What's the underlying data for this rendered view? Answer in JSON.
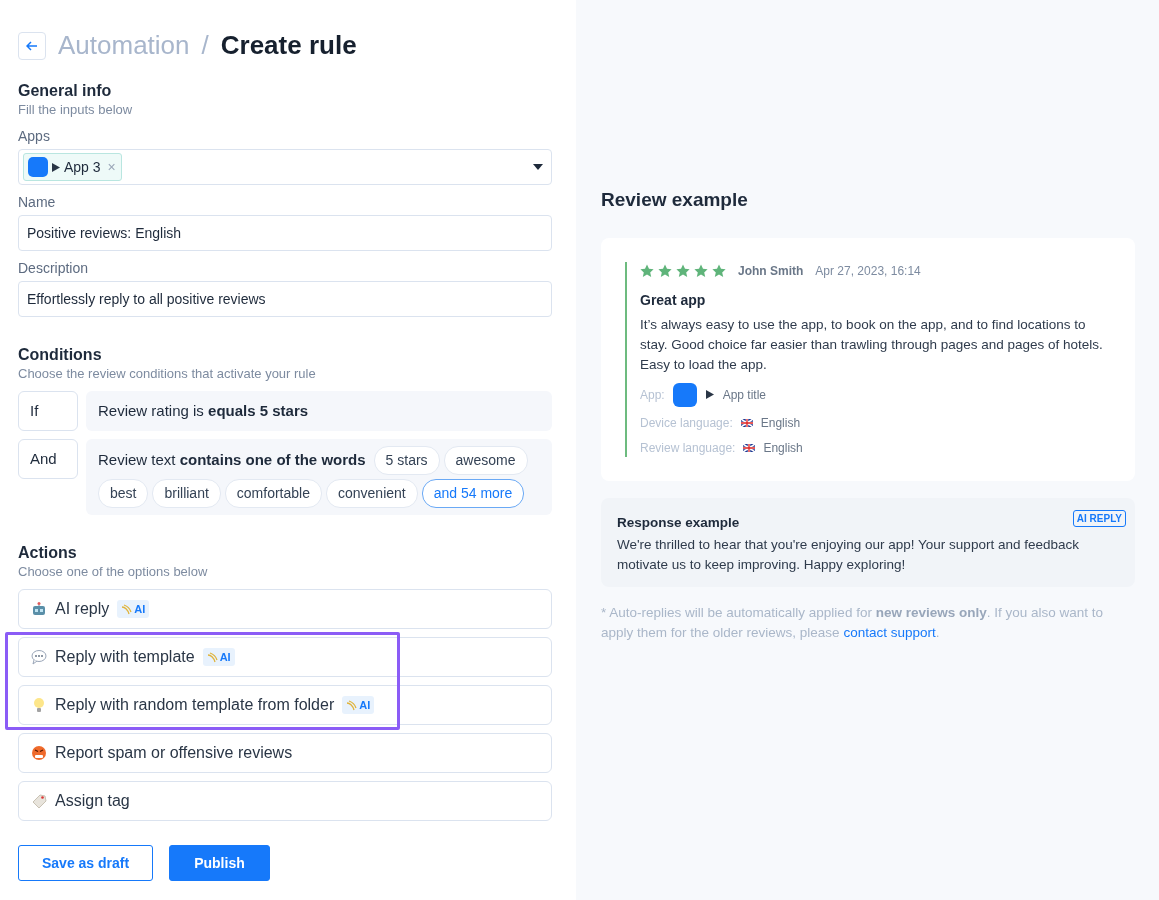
{
  "header": {
    "breadcrumb_parent": "Automation",
    "separator": "/",
    "title": "Create rule"
  },
  "general_info": {
    "heading": "General info",
    "subtitle": "Fill the inputs below",
    "apps": {
      "label": "Apps",
      "chips": [
        {
          "label": "App 3",
          "remove": "×"
        }
      ]
    },
    "name": {
      "label": "Name",
      "value": "Positive reviews: English"
    },
    "description": {
      "label": "Description",
      "value": "Effortlessly reply to all positive reviews"
    }
  },
  "conditions": {
    "heading": "Conditions",
    "subtitle": "Choose the review conditions that activate your rule",
    "rows": [
      {
        "operator": "If",
        "text": "Review rating is **equals 5 stars**",
        "tags": []
      },
      {
        "operator": "And",
        "text": "Review text **contains one of the words**",
        "tags": [
          {
            "label": "5 stars",
            "kind": "word"
          },
          {
            "label": "awesome",
            "kind": "word"
          },
          {
            "label": "best",
            "kind": "word"
          },
          {
            "label": "brilliant",
            "kind": "word"
          },
          {
            "label": "comfortable",
            "kind": "word"
          },
          {
            "label": "convenient",
            "kind": "word"
          },
          {
            "label": "and 54 more",
            "kind": "more"
          }
        ]
      }
    ]
  },
  "actions": {
    "heading": "Actions",
    "subtitle": "Choose one of the options below",
    "items": [
      {
        "label": "AI reply",
        "kind": "robot",
        "ai_badge": "AI",
        "highlighted": false
      },
      {
        "label": "Reply with template",
        "kind": "speech",
        "ai_badge": "AI",
        "highlighted": true
      },
      {
        "label": "Reply with random template from folder",
        "kind": "bulb",
        "ai_badge": "AI",
        "highlighted": true
      },
      {
        "label": "Report spam or offensive reviews",
        "kind": "angry",
        "highlighted": false
      },
      {
        "label": "Assign tag",
        "kind": "tag",
        "highlighted": false
      }
    ]
  },
  "buttons": [
    {
      "label": "Save as draft",
      "kind": "outline"
    },
    {
      "label": "Publish",
      "kind": "primary"
    }
  ],
  "preview": {
    "heading": "Review example",
    "review": {
      "stars": 5,
      "author": "John Smith",
      "date": "Apr 27, 2023, 16:14",
      "title": "Great app",
      "body": "It’s always easy to use the app, to book on the app, and to find locations to stay. Good choice far easier than trawling through pages and pages of hotels. Easy to load the app.",
      "meta": [
        {
          "label": "App:",
          "value": "App title",
          "kind": "app"
        },
        {
          "label": "Device language:",
          "value": "English",
          "kind": "language"
        },
        {
          "label": "Review language:",
          "value": "English",
          "kind": "language"
        }
      ]
    },
    "response": {
      "heading": "Response example",
      "badge": "AI REPLY",
      "text": "We're thrilled to hear that you're enjoying our app!  Your support and feedback motivate us to keep improving. Happy exploring!"
    },
    "footnote": {
      "before": "* Auto-replies will be automatically applied for **new reviews only**. If you also want to apply them for the older reviews, please ",
      "link": "contact support",
      "after": "."
    }
  }
}
